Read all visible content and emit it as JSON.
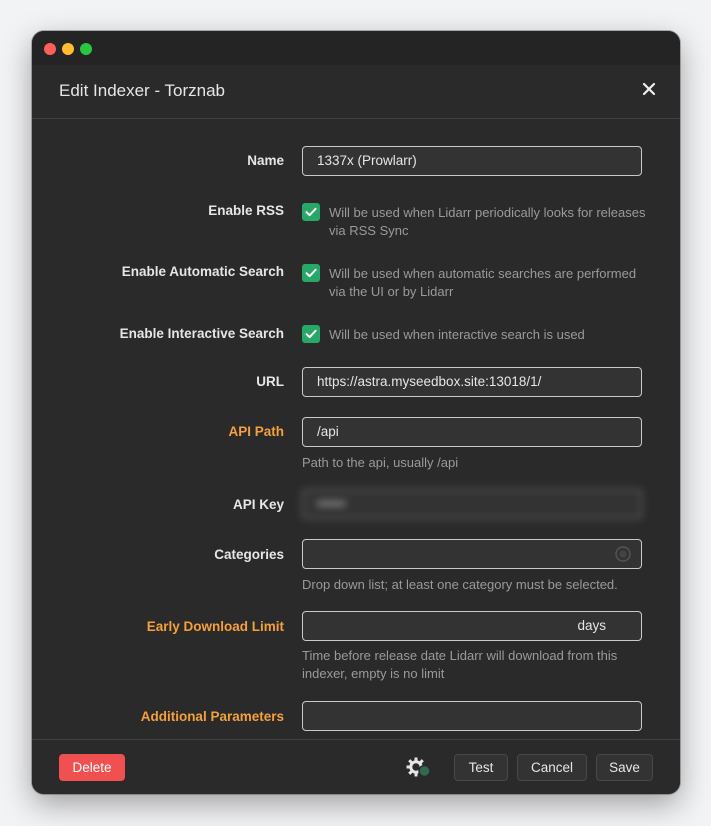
{
  "window": {
    "title": "Edit Indexer - Torznab"
  },
  "fields": {
    "name": {
      "label": "Name",
      "value": "1337x (Prowlarr)"
    },
    "enable_rss": {
      "label": "Enable RSS",
      "help": "Will be used when Lidarr periodically looks for releases via RSS Sync",
      "checked": true
    },
    "enable_auto": {
      "label": "Enable Automatic Search",
      "help": "Will be used when automatic searches are performed via the UI or by Lidarr",
      "checked": true
    },
    "enable_interactive": {
      "label": "Enable Interactive Search",
      "help": "Will be used when interactive search is used",
      "checked": true
    },
    "url": {
      "label": "URL",
      "value": "https://astra.myseedbox.site:13018/1/"
    },
    "api_path": {
      "label": "API Path",
      "value": "/api",
      "help": "Path to the api, usually /api"
    },
    "api_key": {
      "label": "API Key",
      "value": "••••••"
    },
    "categories": {
      "label": "Categories",
      "value": "",
      "help": "Drop down list; at least one category must be selected."
    },
    "early_download": {
      "label": "Early Download Limit",
      "value": "",
      "suffix": "days",
      "help": "Time before release date Lidarr will download from this indexer, empty is no limit"
    },
    "additional_params": {
      "label": "Additional Parameters",
      "value": ""
    }
  },
  "footer": {
    "delete_label": "Delete",
    "test_label": "Test",
    "cancel_label": "Cancel",
    "save_label": "Save"
  },
  "colors": {
    "background": "#2a2a2a",
    "warning_label": "#f5a03a",
    "checkbox": "#27a869",
    "danger": "#f05050"
  },
  "icons": [
    "close-icon",
    "check-icon",
    "select-circle-icon",
    "advanced-settings-gear-icon"
  ]
}
